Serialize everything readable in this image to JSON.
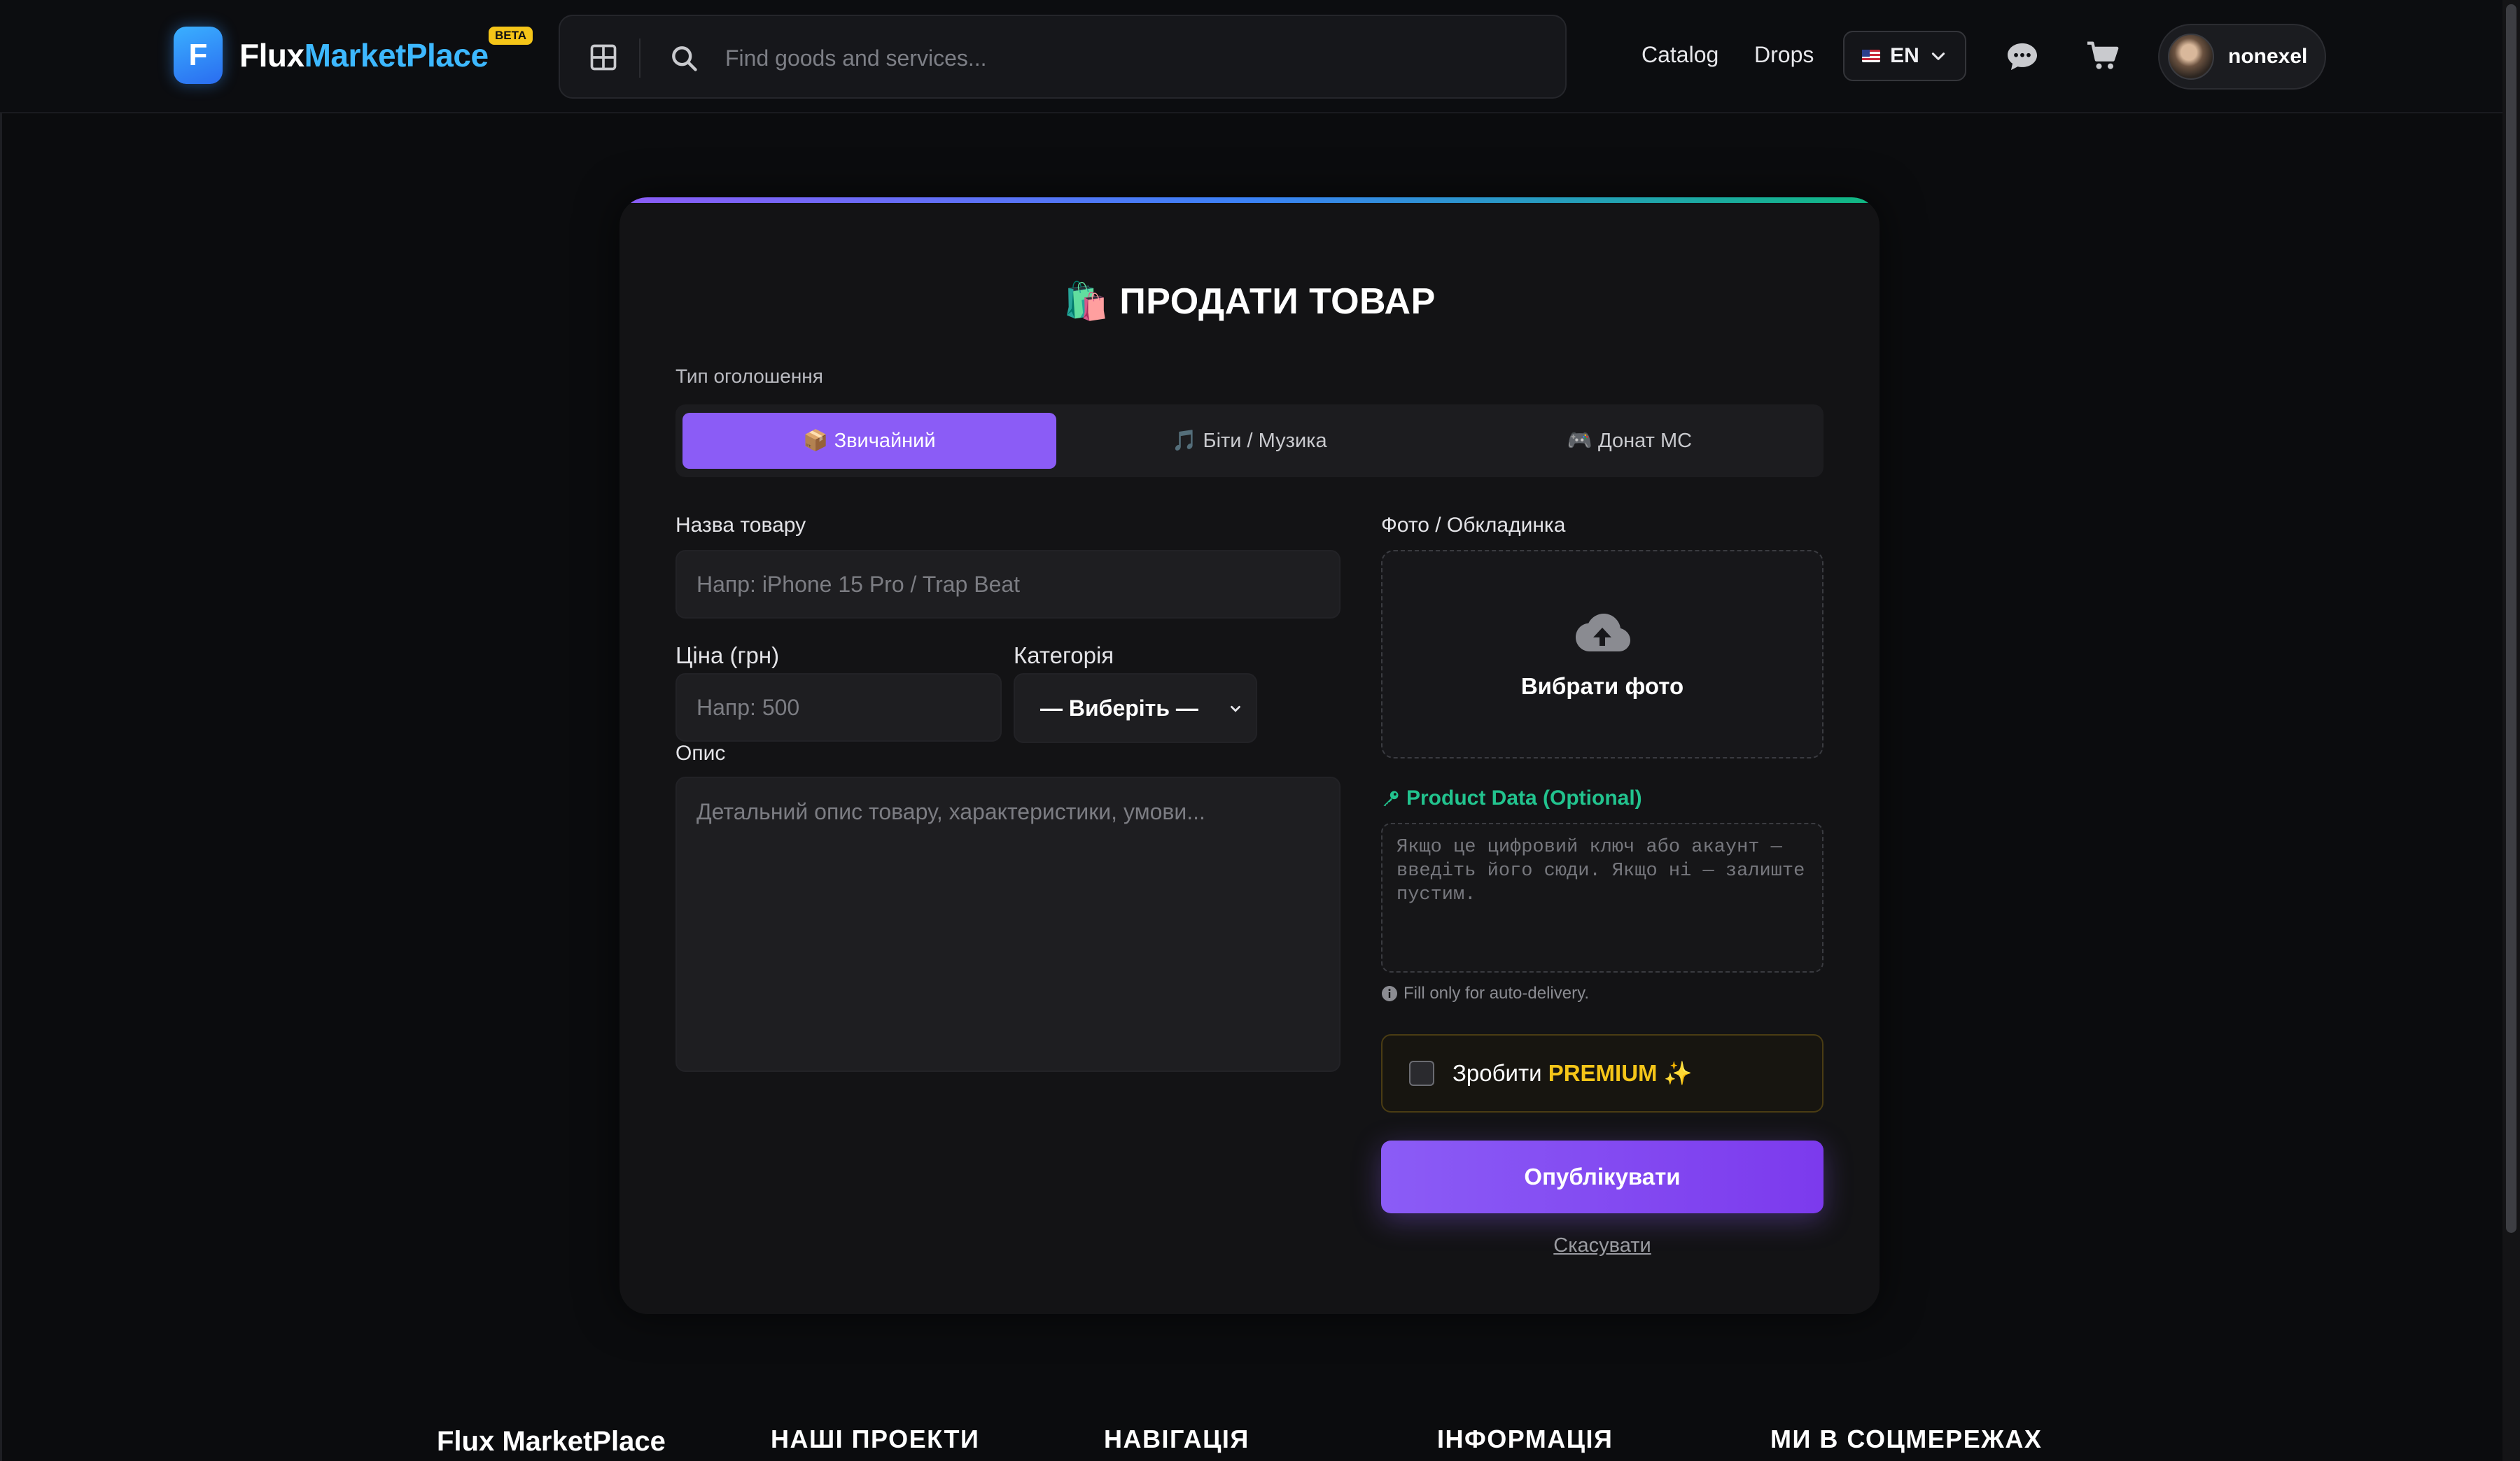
{
  "header": {
    "logo_letter": "F",
    "logo_part1": "Flux",
    "logo_part2": "MarketPlace",
    "beta": "BETA",
    "search_placeholder": "Find goods and services...",
    "nav": {
      "catalog": "Catalog",
      "drops": "Drops"
    },
    "language": "EN",
    "username": "nonexel",
    "icons": [
      "grid-icon",
      "search-icon",
      "chat-icon",
      "cart-icon",
      "chevron-down-icon"
    ]
  },
  "form": {
    "title": "🛍️ ПРОДАТИ ТОВАР",
    "listing_type_label": "Тип оголошення",
    "listing_types": [
      {
        "label": "📦 Звичайний",
        "active": true
      },
      {
        "label": "🎵 Біти / Музика",
        "active": false
      },
      {
        "label": "🎮 Донат MC",
        "active": false
      }
    ],
    "name_label": "Назва товару",
    "name_placeholder": "Напр: iPhone 15 Pro / Trap Beat",
    "price_label": "Ціна (грн)",
    "price_placeholder": "Напр: 500",
    "category_label": "Категорія",
    "category_selected": "— Виберіть —",
    "description_label": "Опис",
    "description_placeholder": "Детальний опис товару, характеристики, умови...",
    "photo_label": "Фото / Обкладинка",
    "photo_button": "Вибрати фото",
    "product_data_label": "Product Data (Optional)",
    "product_data_placeholder": "Якщо це цифровий ключ або акаунт — введіть його сюди. Якщо ні — залиште пустим.",
    "product_data_hint": "Fill only for auto-delivery.",
    "premium_prefix": "Зробити",
    "premium_word": "PREMIUM",
    "premium_suffix": "✨",
    "publish_button": "Опублікувати",
    "cancel_link": "Скасувати"
  },
  "footer": {
    "brand": "Flux MarketPlace",
    "col1": "НАШІ ПРОЕКТИ",
    "col2": "НАВІГАЦІЯ",
    "col3": "ІНФОРМАЦІЯ",
    "col4": "МИ В СОЦМЕРЕЖАХ"
  },
  "colors": {
    "accent": "#8b5cf6",
    "brand_blue": "#3db8ff",
    "product_data_green": "#22c38e",
    "premium_gold": "#f5c518",
    "background": "#0b0c0e",
    "card": "#131315"
  }
}
